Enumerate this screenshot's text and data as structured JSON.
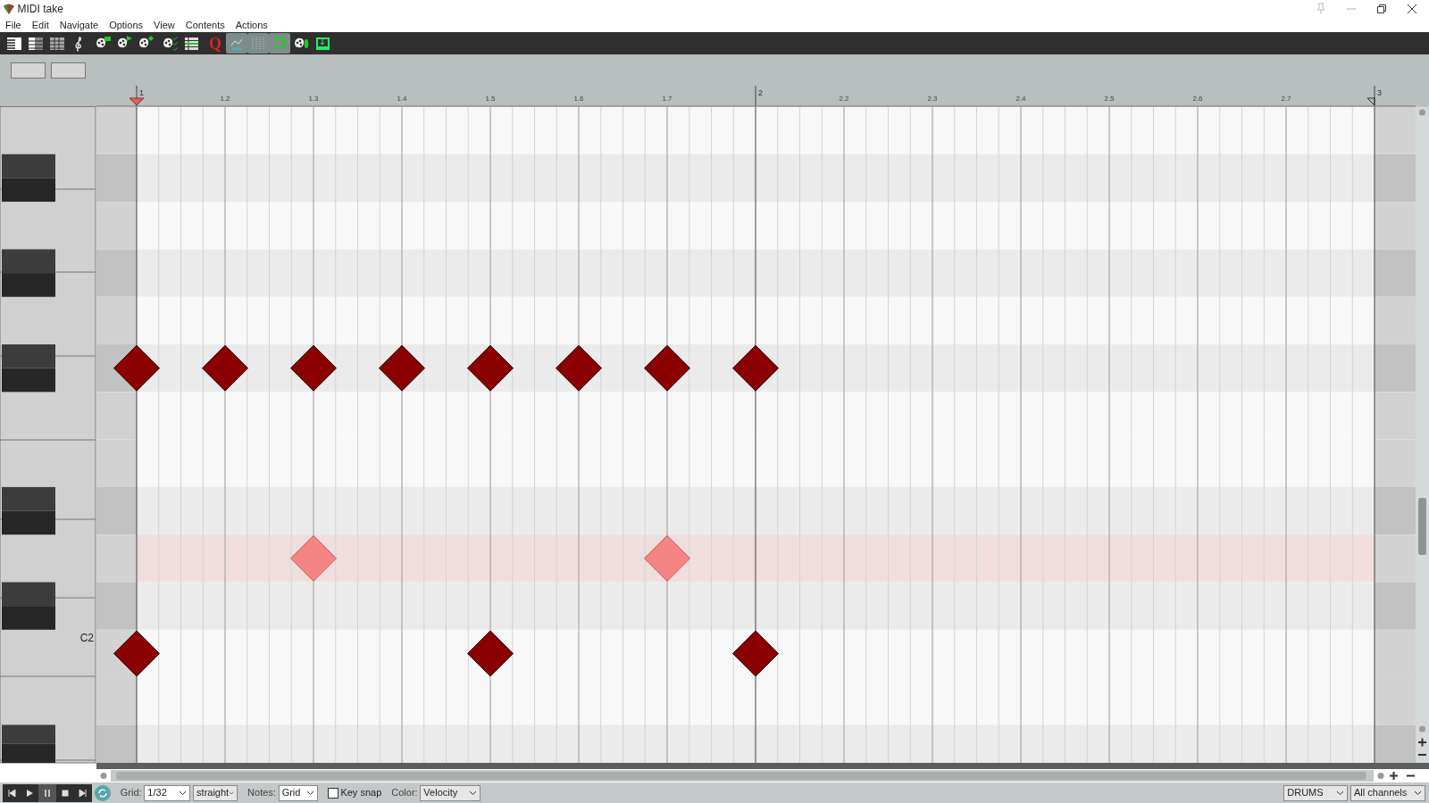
{
  "window": {
    "title": "MIDI take"
  },
  "menu": [
    "File",
    "Edit",
    "Navigate",
    "Options",
    "View",
    "Contents",
    "Actions"
  ],
  "toolbar": [
    {
      "kind": "keys",
      "on": false
    },
    {
      "kind": "named",
      "on": false
    },
    {
      "kind": "blocks",
      "on": false
    },
    {
      "kind": "clef",
      "on": false
    },
    {
      "kind": "palette-rect",
      "on": false
    },
    {
      "kind": "palette-play",
      "on": false
    },
    {
      "kind": "palette-diamond",
      "on": false
    },
    {
      "kind": "palette-check",
      "on": false
    },
    {
      "kind": "list",
      "on": false
    },
    {
      "kind": "quantize",
      "label": "Q",
      "on": false
    },
    {
      "kind": "cc",
      "on": true
    },
    {
      "kind": "dots",
      "on": true
    },
    {
      "kind": "loop",
      "on": true
    },
    {
      "kind": "step",
      "on": false
    },
    {
      "kind": "insert",
      "on": false
    }
  ],
  "ruler": {
    "measures": [
      {
        "label": "1",
        "beats": [
          "1.2",
          "1.3",
          "1.4",
          "1.5",
          "1.6",
          "1.7"
        ]
      },
      {
        "label": "2",
        "beats": [
          "2.2",
          "2.3",
          "2.4",
          "2.5",
          "2.6",
          "2.7"
        ]
      },
      {
        "label": "3"
      }
    ]
  },
  "rows": [
    {
      "kind": "natural",
      "selected": false
    },
    {
      "kind": "sharp",
      "selected": false
    },
    {
      "kind": "natural",
      "selected": false
    },
    {
      "kind": "sharp",
      "selected": false
    },
    {
      "kind": "natural",
      "selected": false
    },
    {
      "kind": "sharp",
      "selected": false,
      "notes": [
        {
          "kind": "note",
          "selected": false
        },
        {
          "kind": "note",
          "selected": false
        },
        {
          "kind": "note",
          "selected": false
        },
        {
          "kind": "note",
          "selected": false
        },
        {
          "kind": "note",
          "selected": false
        },
        {
          "kind": "note",
          "selected": false
        },
        {
          "kind": "note",
          "selected": false
        },
        {
          "kind": "note",
          "selected": false
        }
      ]
    },
    {
      "kind": "natural",
      "selected": false
    },
    {
      "kind": "natural",
      "selected": false
    },
    {
      "kind": "sharp",
      "selected": false
    },
    {
      "kind": "natural",
      "selected": true,
      "notes": [
        {
          "kind": "rest"
        },
        {
          "kind": "rest"
        },
        {
          "kind": "note",
          "selected": true
        },
        {
          "kind": "rest"
        },
        {
          "kind": "rest"
        },
        {
          "kind": "rest"
        },
        {
          "kind": "note",
          "selected": true
        }
      ]
    },
    {
      "kind": "sharp",
      "selected": false
    },
    {
      "kind": "natural",
      "selected": false,
      "label": "C2",
      "notes": [
        {
          "kind": "note",
          "selected": false
        },
        {
          "kind": "rest"
        },
        {
          "kind": "rest"
        },
        {
          "kind": "rest"
        },
        {
          "kind": "note",
          "selected": false
        },
        {
          "kind": "rest"
        },
        {
          "kind": "rest"
        },
        {
          "kind": "note",
          "selected": false
        }
      ]
    },
    {
      "kind": "natural",
      "selected": false
    },
    {
      "kind": "sharp",
      "selected": false
    }
  ],
  "transport": [
    {
      "kind": "skip-back",
      "on": false
    },
    {
      "kind": "play",
      "on": false
    },
    {
      "kind": "pause",
      "on": true
    },
    {
      "kind": "stop",
      "on": false
    },
    {
      "kind": "skip-forward",
      "on": false
    }
  ],
  "repeat": {
    "on": true
  },
  "grid": {
    "label": "Grid:",
    "value": "1/32",
    "swing": "straight"
  },
  "notes": {
    "label": "Notes:",
    "value": "Grid"
  },
  "key_snap": {
    "label": "Key snap",
    "checked": false
  },
  "color": {
    "label": "Color:",
    "value": "Velocity"
  },
  "mode": "DRUMS",
  "channels": "All channels"
}
